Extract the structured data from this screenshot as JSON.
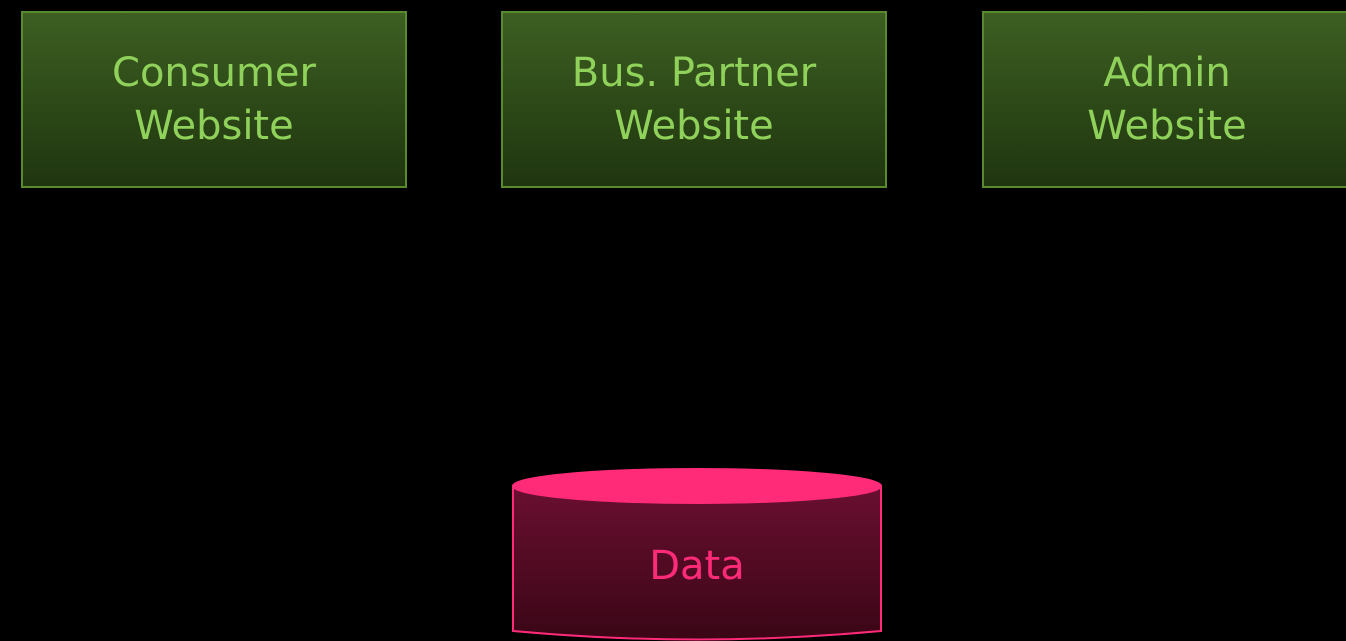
{
  "diagram": {
    "boxes": [
      {
        "id": "consumer",
        "lines": [
          "Consumer",
          "Website"
        ]
      },
      {
        "id": "partner",
        "lines": [
          "Bus. Partner",
          "Website"
        ]
      },
      {
        "id": "admin",
        "lines": [
          "Admin",
          "Website"
        ]
      }
    ],
    "database": {
      "label": "Data"
    },
    "colors": {
      "background": "#000000",
      "box_text": "#8fd15a",
      "box_border": "#5a8a2e",
      "box_fill": "#2c4817",
      "db_text": "#ff2a78",
      "db_top": "#ff2a78",
      "db_fill": "#4a0a22"
    }
  }
}
